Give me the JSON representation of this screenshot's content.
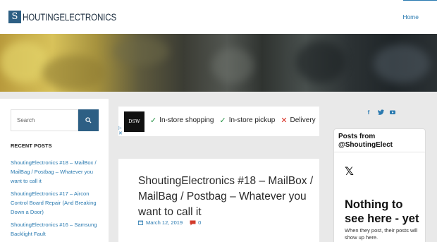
{
  "header": {
    "logo_mark": "S",
    "logo_text": "HOUTINGELECTRONICS",
    "nav_home": "Home"
  },
  "sidebar": {
    "search_placeholder": "Search",
    "recent_posts_title": "RECENT POSTS",
    "recent_posts": [
      "ShoutingElectronics #18 – MailBox / MailBag / Postbag – Whatever you want to call it",
      "ShoutingElectronics #17 – Aircon Control Board Repair (And Breaking Down a Door)",
      "ShoutingElectronics #16 – Samsung Backlight Fault"
    ]
  },
  "ad": {
    "logo": "DSW",
    "items": [
      {
        "icon": "check-icon",
        "text": "In-store shopping"
      },
      {
        "icon": "check-icon",
        "text": "In-store pickup"
      },
      {
        "icon": "cross-icon",
        "text": "Delivery"
      }
    ],
    "close": "✕"
  },
  "post": {
    "title": "ShoutingElectronics #18 – MailBox / MailBag / Postbag – Whatever you want to call it",
    "date": "March 12, 2019",
    "comments": "0"
  },
  "social": [
    "facebook-icon",
    "twitter-icon",
    "youtube-icon"
  ],
  "twitter_widget": {
    "header": "Posts from @ShoutingElect",
    "logo": "𝕏",
    "headline": "Nothing to see here - yet",
    "subtext": "When they post, their posts will show up here."
  },
  "colors": {
    "accent": "#2a7ab0",
    "brand_dark": "#2d5f84",
    "check": "#1e8e3e",
    "cross": "#d93025"
  }
}
